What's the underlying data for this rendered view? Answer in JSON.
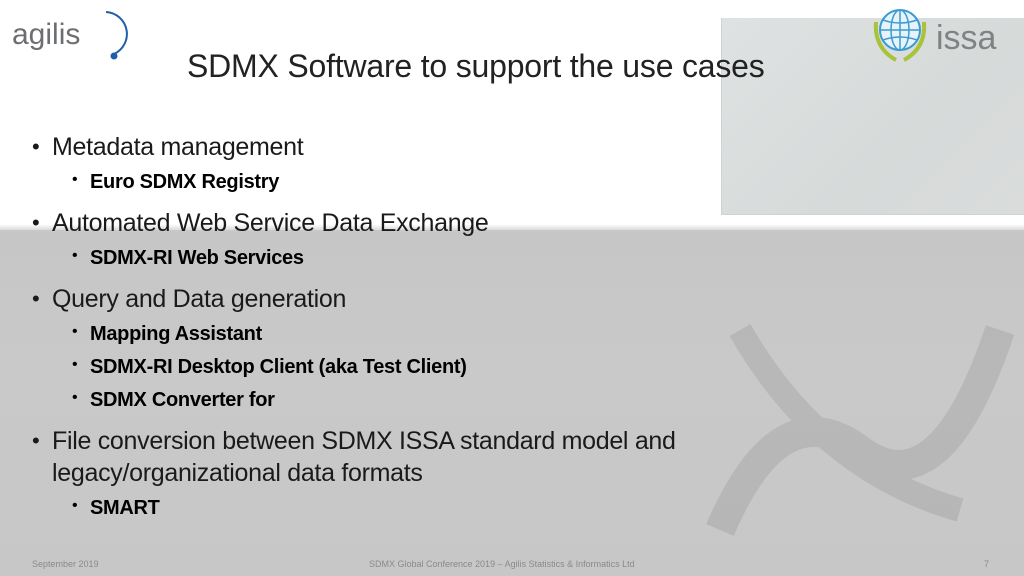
{
  "logos": {
    "left": {
      "name": "agilis",
      "text": "agilis"
    },
    "right": {
      "name": "issa",
      "text": "issa"
    }
  },
  "slide": {
    "title": "SDMX Software to support the use cases",
    "bullets": [
      {
        "text": "Metadata management",
        "sub": [
          "Euro SDMX Registry"
        ]
      },
      {
        "text": "Automated Web Service Data Exchange",
        "sub": [
          "SDMX-RI Web Services"
        ]
      },
      {
        "text": "Query and Data generation",
        "sub": [
          "Mapping Assistant",
          "SDMX-RI Desktop Client (aka Test Client)",
          "SDMX Converter for"
        ]
      },
      {
        "text_line1": "File conversion between SDMX ISSA standard model and",
        "text_line2": "legacy/organizational data formats",
        "sub": [
          "SMART"
        ]
      }
    ],
    "bullet_glyph": "•"
  },
  "footer": {
    "date": "September 2019",
    "center": "SDMX Global Conference 2019 – Agilis Statistics & Informatics Ltd",
    "page_number": "7"
  },
  "colors": {
    "agilis_blue": "#1f5fa8",
    "agilis_gray": "#6d6e71",
    "issa_globe": "#3c9bd0",
    "issa_laurel": "#a8c23a",
    "issa_text": "#808285"
  }
}
